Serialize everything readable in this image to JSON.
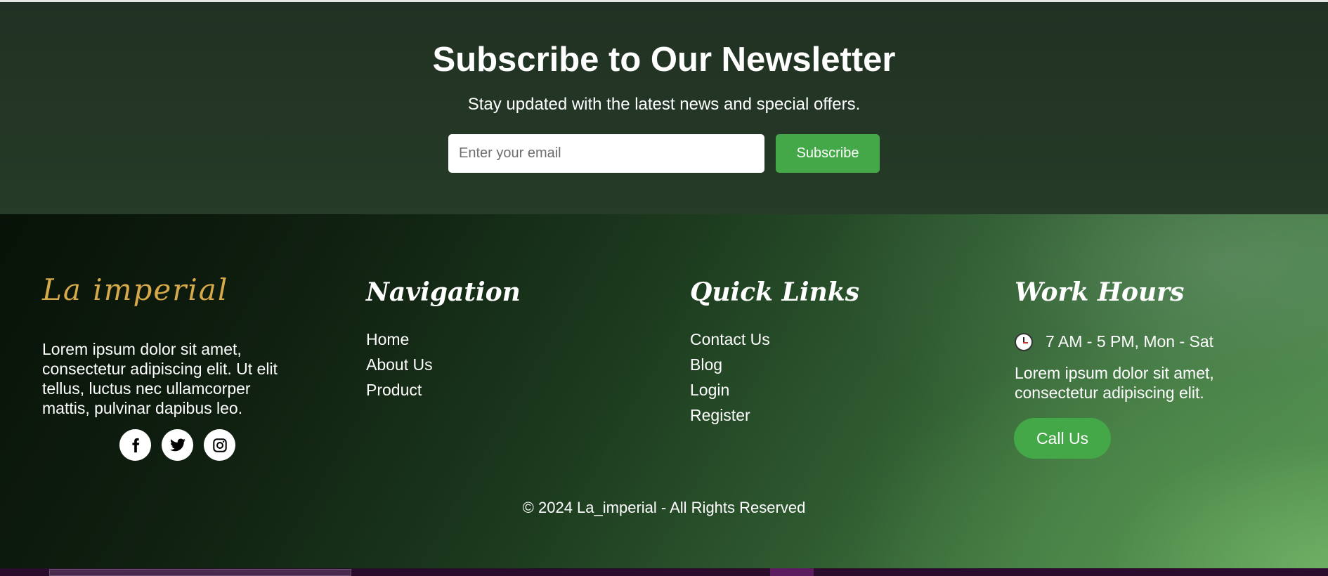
{
  "newsletter": {
    "title": "Subscribe to Our Newsletter",
    "subtitle": "Stay updated with the latest news and special offers.",
    "email_placeholder": "Enter your email",
    "subscribe_label": "Subscribe"
  },
  "footer": {
    "logo_text": "La  imperial",
    "about_text": "Lorem ipsum dolor sit amet, consectetur adipiscing elit. Ut elit tellus, luctus nec ullamcorper mattis, pulvinar dapibus leo.",
    "socials": [
      {
        "icon": "facebook-icon"
      },
      {
        "icon": "twitter-icon"
      },
      {
        "icon": "instagram-icon"
      }
    ],
    "navigation": {
      "title": "Navigation",
      "items": [
        "Home",
        "About Us",
        "Product"
      ]
    },
    "quick_links": {
      "title": "Quick Links",
      "items": [
        "Contact Us",
        "Blog",
        "Login",
        "Register"
      ]
    },
    "work_hours": {
      "title": "Work Hours",
      "hours": "7 AM - 5 PM, Mon - Sat",
      "icon": "clock-icon",
      "text": "Lorem ipsum dolor sit amet, consectetur adipiscing elit.",
      "call_label": "Call Us"
    },
    "copyright": "© 2024 La_imperial - All Rights Reserved"
  },
  "colors": {
    "accent_green": "#45a848",
    "logo_gold": "#d6a94a",
    "newsletter_bg": "#213123"
  }
}
